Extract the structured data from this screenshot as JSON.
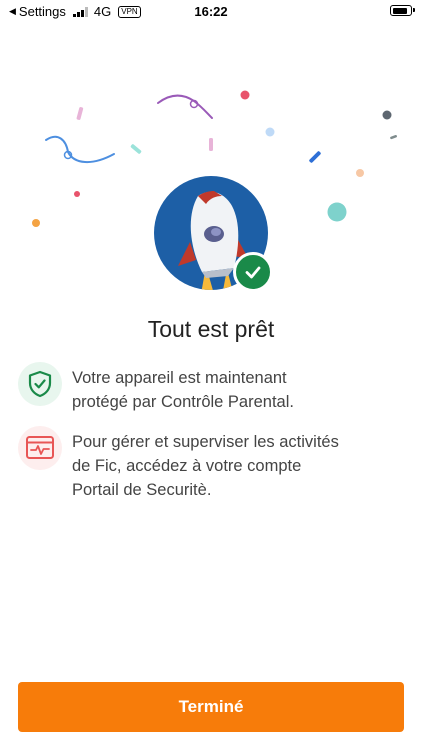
{
  "status_bar": {
    "back_label": "Settings",
    "network": "4G",
    "vpn": "VPN",
    "time": "16:22"
  },
  "title": "Tout est prêt",
  "items": [
    {
      "icon": "shield-check-icon",
      "text_lines": [
        "Votre appareil est maintenant",
        "protégé par Contrôle Parental."
      ]
    },
    {
      "icon": "activity-monitor-icon",
      "text_lines": [
        "Pour gérer et superviser les activités",
        "de Fic, accédez à votre compte",
        "Portail de Securitè."
      ]
    }
  ],
  "button": {
    "label": "Terminé"
  },
  "colors": {
    "accent_orange": "#f77c0a",
    "success_green": "#1a8a49",
    "hero_blue": "#1d5fa6",
    "alert_red": "#e85555"
  }
}
